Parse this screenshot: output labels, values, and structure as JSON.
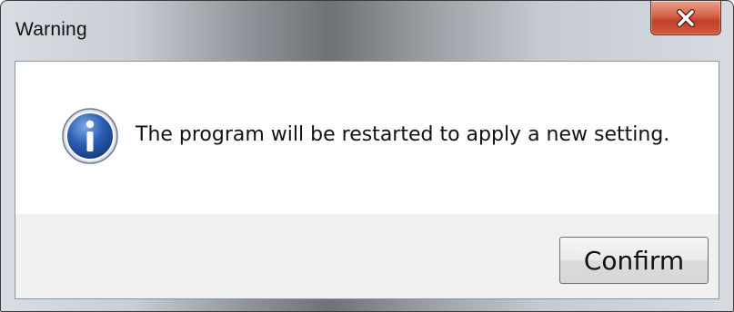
{
  "dialog": {
    "title": "Warning",
    "message": "The program will be restarted to apply a new setting.",
    "icon": "info-icon",
    "close_icon": "close-icon"
  },
  "buttons": {
    "confirm_label": "Confirm"
  },
  "colors": {
    "close_button": "#c3402a",
    "info_icon_blue": "#1f4f9e",
    "button_area": "#f0f0f0"
  }
}
